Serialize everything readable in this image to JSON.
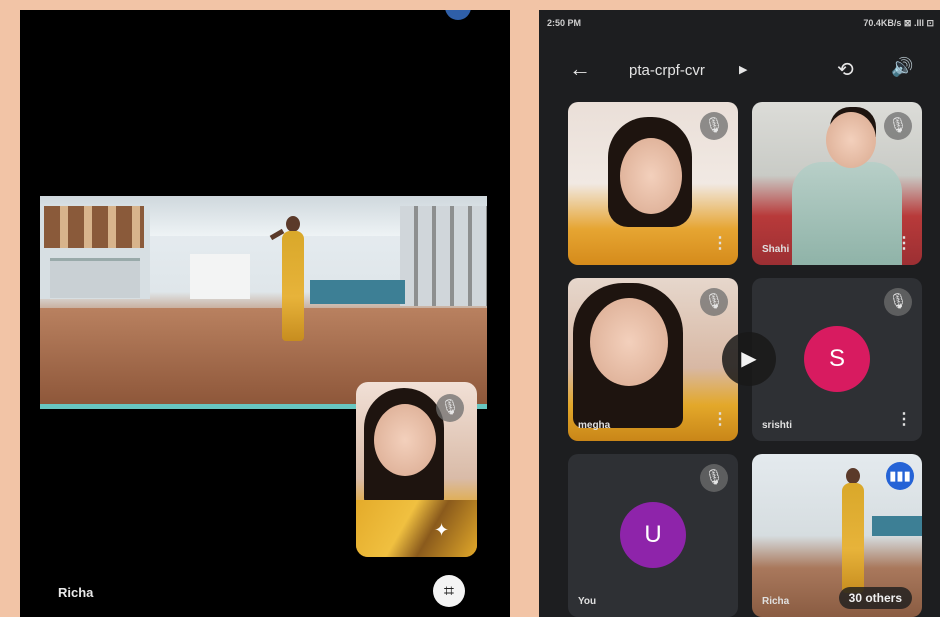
{
  "left_phone": {
    "main_participant_name": "Richa",
    "self_view": {
      "muted": true
    },
    "controls": {
      "grid_icon": "grid-view-icon"
    }
  },
  "right_phone": {
    "status_bar": {
      "time": "2:50 PM",
      "indicators": "70.4KB/s ⊠ .Ill ⊡"
    },
    "meeting_title": "pta-crpf-cvr",
    "tiles": [
      {
        "name": "",
        "muted": true,
        "type": "video"
      },
      {
        "name": "Shahi",
        "muted": true,
        "type": "video"
      },
      {
        "name": "megha",
        "muted": true,
        "type": "video"
      },
      {
        "name": "srishti",
        "muted": true,
        "type": "avatar",
        "initial": "S",
        "avatar_color": "#d81b60"
      },
      {
        "name": "You",
        "muted": true,
        "type": "avatar",
        "initial": "U",
        "avatar_color": "#8e24aa"
      },
      {
        "name": "Richa",
        "muted": false,
        "type": "video",
        "speaking": true
      }
    ],
    "others_count_label": "30 others"
  }
}
